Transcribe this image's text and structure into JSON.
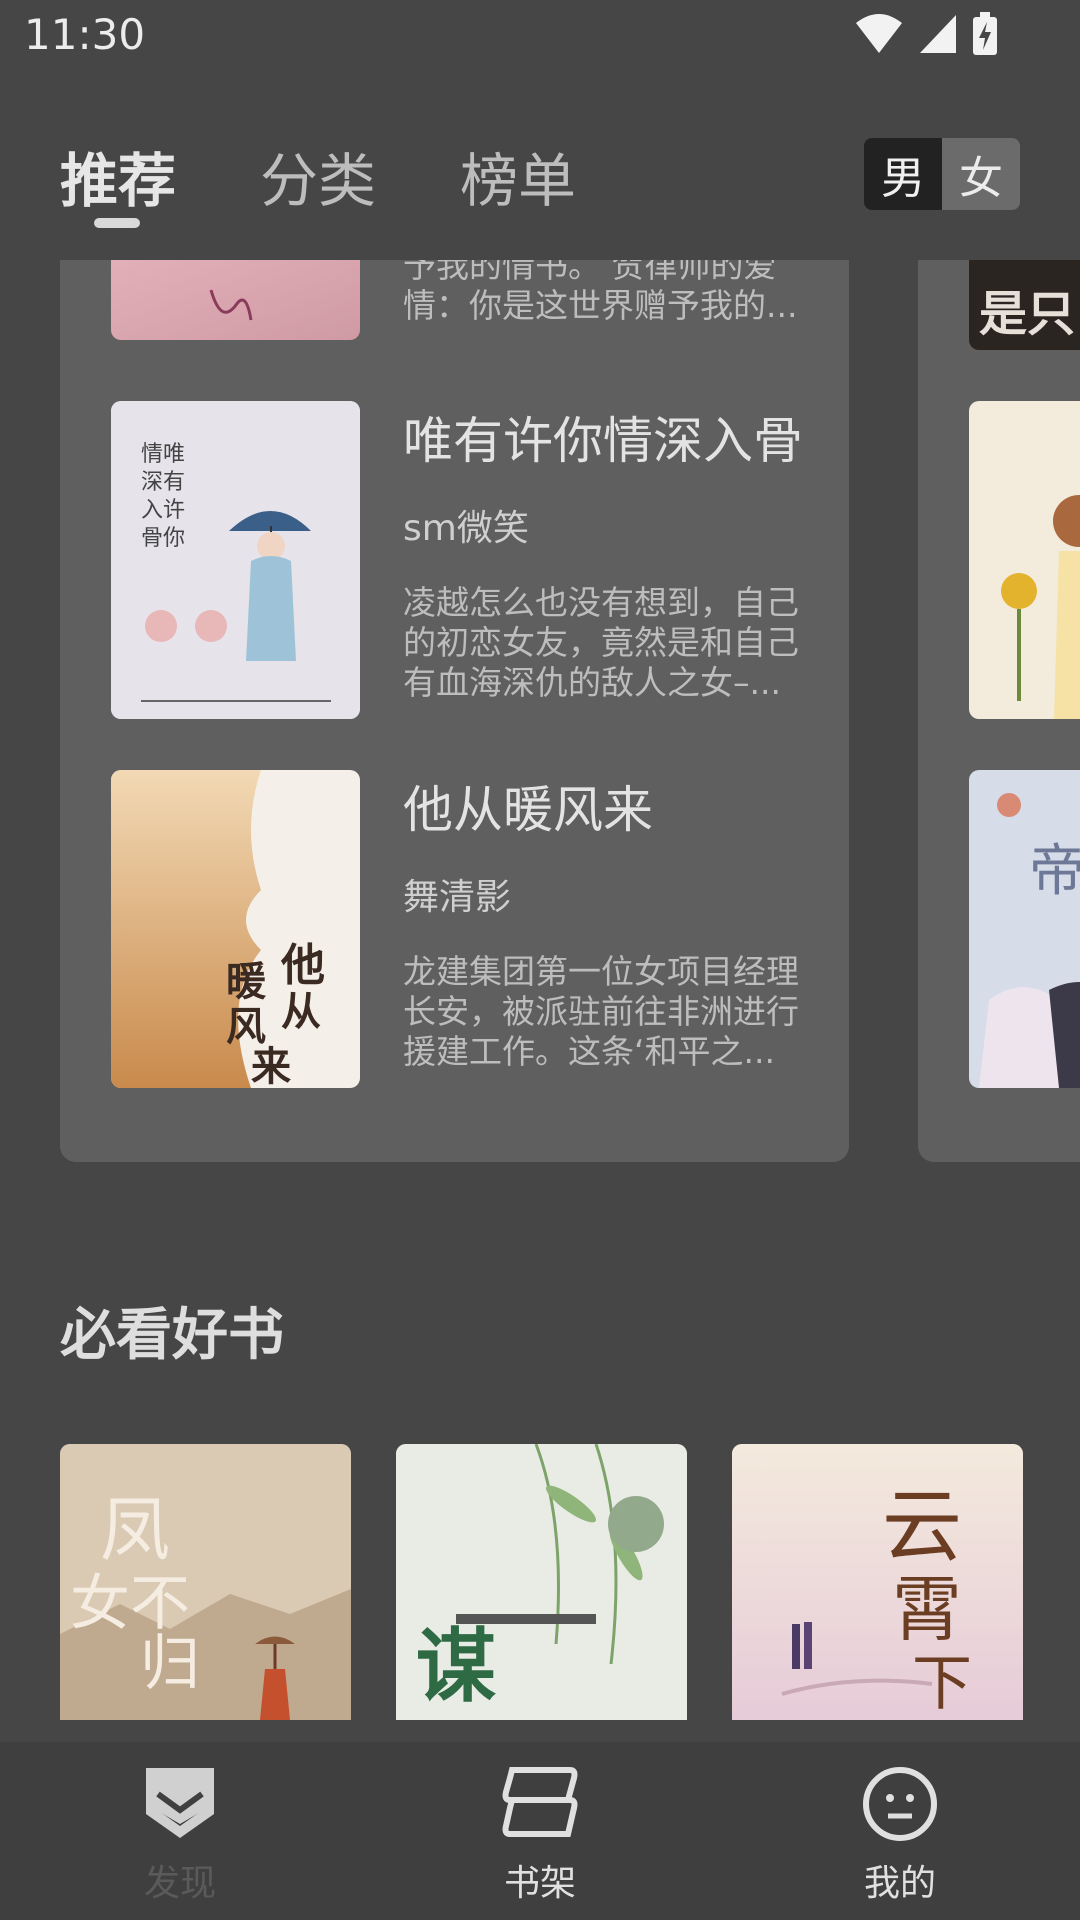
{
  "status": {
    "time": "11:30"
  },
  "tabs": [
    {
      "label": "推荐"
    },
    {
      "label": "分类"
    },
    {
      "label": "榜单"
    }
  ],
  "gender": {
    "male": "男",
    "female": "女",
    "selected": "male"
  },
  "partial_book": {
    "desc": "予我的情书。 贺律师的爱情：你是这世界赠予我的..."
  },
  "books": [
    {
      "title": "唯有许你情深入骨",
      "author": " sm微笑",
      "desc": "凌越怎么也没有想到，自己的初恋女友，竟然是和自己有血海深仇的敌人之女–..."
    },
    {
      "title": "他从暖风来",
      "author": "舞清影",
      "desc": "龙建集团第一位女项目经理长安，被派驻前往非洲进行援建工作。这条‘和平之..."
    }
  ],
  "section": {
    "title": "必看好书"
  },
  "bottom_nav": [
    {
      "label": "发现",
      "icon": "discover-icon",
      "active": true
    },
    {
      "label": "书架",
      "icon": "bookshelf-icon",
      "active": false
    },
    {
      "label": "我的",
      "icon": "profile-icon",
      "active": false
    }
  ]
}
